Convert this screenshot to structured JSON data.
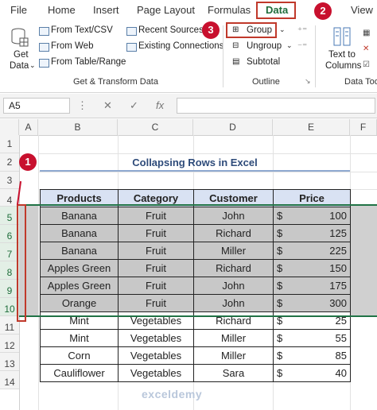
{
  "ribbon_tabs": [
    "File",
    "Home",
    "Insert",
    "Page Layout",
    "Formulas",
    "Data",
    "View"
  ],
  "active_tab": "Data",
  "get_transform": {
    "get_data_line1": "Get",
    "get_data_line2": "Data",
    "from_text_csv": "From Text/CSV",
    "from_web": "From Web",
    "from_table_range": "From Table/Range",
    "recent_sources": "Recent Sources",
    "existing_connections": "Existing Connections",
    "group_label": "Get & Transform Data"
  },
  "outline": {
    "group_label": "Group",
    "ungroup_label": "Ungroup",
    "subtotal_label": "Subtotal",
    "section_label": "Outline"
  },
  "data_tools": {
    "text_to_line1": "Text to",
    "text_to_line2": "Columns",
    "section_label": "Data Too"
  },
  "badges": [
    "1",
    "2",
    "3"
  ],
  "formula_bar": {
    "name_box": "A5",
    "fx": "fx"
  },
  "columns": [
    "A",
    "B",
    "C",
    "D",
    "E",
    "F"
  ],
  "rows": [
    "1",
    "2",
    "3",
    "4",
    "5",
    "6",
    "7",
    "8",
    "9",
    "10",
    "11",
    "12",
    "13",
    "14"
  ],
  "sheet_title": "Collapsing Rows in Excel",
  "table": {
    "headers": [
      "Products",
      "Category",
      "Customer",
      "Price"
    ],
    "currency": "$",
    "rows": [
      {
        "product": "Banana",
        "category": "Fruit",
        "customer": "John",
        "price": "100"
      },
      {
        "product": "Banana",
        "category": "Fruit",
        "customer": "Richard",
        "price": "125"
      },
      {
        "product": "Banana",
        "category": "Fruit",
        "customer": "Miller",
        "price": "225"
      },
      {
        "product": "Apples Green",
        "category": "Fruit",
        "customer": "Richard",
        "price": "150"
      },
      {
        "product": "Apples Green",
        "category": "Fruit",
        "customer": "John",
        "price": "175"
      },
      {
        "product": "Orange",
        "category": "Fruit",
        "customer": "John",
        "price": "300"
      },
      {
        "product": "Mint",
        "category": "Vegetables",
        "customer": "Richard",
        "price": "25"
      },
      {
        "product": "Mint",
        "category": "Vegetables",
        "customer": "Miller",
        "price": "55"
      },
      {
        "product": "Corn",
        "category": "Vegetables",
        "customer": "Miller",
        "price": "85"
      },
      {
        "product": "Cauliflower",
        "category": "Vegetables",
        "customer": "Sara",
        "price": "40"
      }
    ]
  },
  "watermark": "exceldemy",
  "colors": {
    "accent": "#217346",
    "callout": "#c8102e",
    "header_fill": "#d9e2f3",
    "grouped_fill": "#c8c8c8"
  }
}
